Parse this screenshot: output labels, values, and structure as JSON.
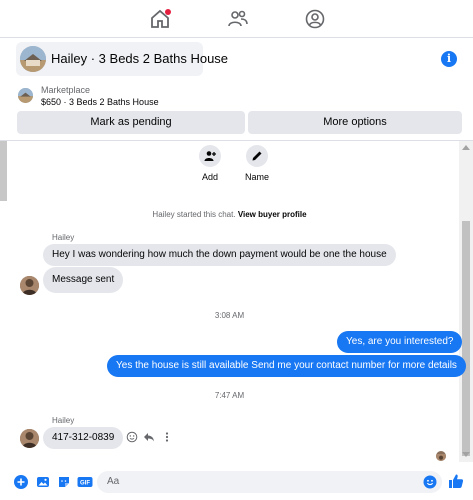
{
  "nav": {
    "home_icon": "home-icon",
    "people_icon": "people-icon",
    "profile_icon": "user-circle-icon",
    "notification_dot_color": "#e41e3f"
  },
  "header": {
    "title": "Hailey · 3 Beds 2 Baths House",
    "info_icon": "info-icon",
    "marketplace_label": "Marketplace",
    "listing": "$650 · 3 Beds 2 Baths House",
    "mark_pending": "Mark as pending",
    "more_options": "More options"
  },
  "actions": {
    "add_label": "Add",
    "name_label": "Name"
  },
  "chat": {
    "started_name": "Hailey started this chat.",
    "view_profile": "View buyer profile",
    "sender1": "Hailey",
    "msg1": "Hey I was wondering how much the down payment would be one the house",
    "msg2": "Message sent",
    "time1": "3:08 AM",
    "out1": "Yes, are you interested?",
    "out2": "Yes the house is still available Send me your contact number for more details",
    "time2": "7:47 AM",
    "sender2": "Hailey",
    "msg3": "417-312-0839"
  },
  "composer": {
    "placeholder": "Aa"
  },
  "colors": {
    "accent": "#1877f2",
    "bubble_in": "#e4e6eb",
    "secondary_text": "#65676b"
  }
}
